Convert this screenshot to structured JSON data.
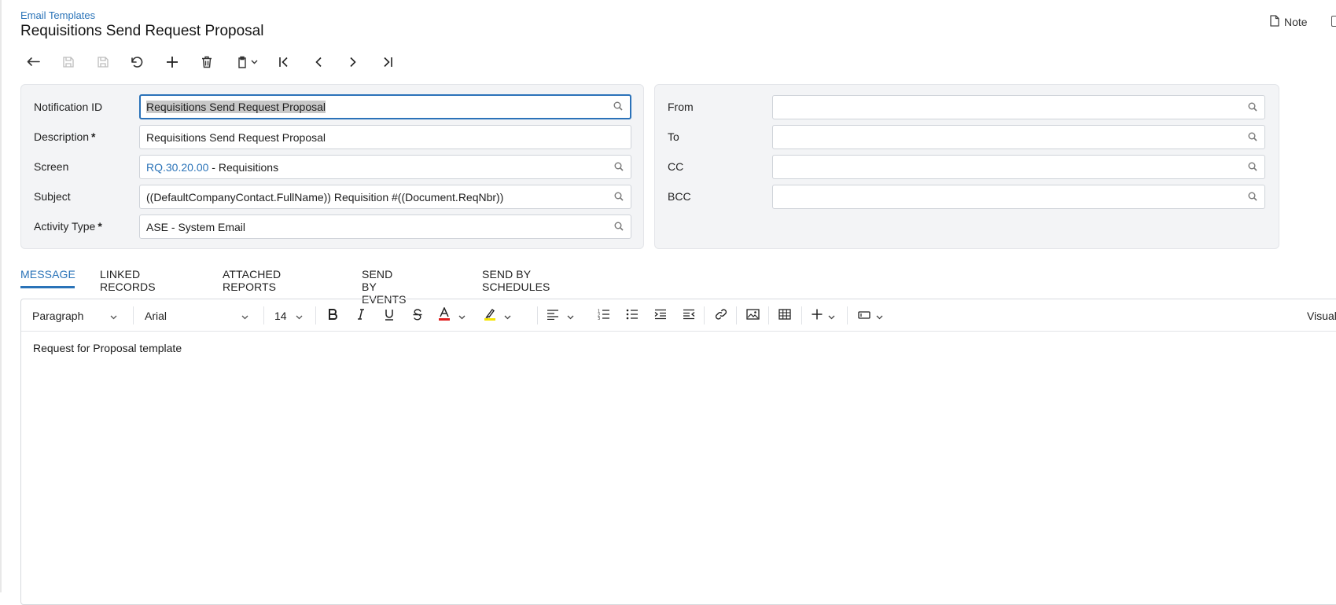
{
  "header": {
    "breadcrumb": "Email Templates",
    "title": "Requisitions Send Request Proposal",
    "note_label": "Note"
  },
  "form": {
    "notification_id": {
      "label": "Notification ID",
      "value": "Requisitions Send Request Proposal"
    },
    "description": {
      "label": "Description",
      "required": "*",
      "value": "Requisitions Send Request Proposal"
    },
    "screen": {
      "label": "Screen",
      "code": "RQ.30.20.00",
      "name": " - Requisitions"
    },
    "subject": {
      "label": "Subject",
      "value": "((DefaultCompanyContact.FullName)) Requisition #((Document.ReqNbr))"
    },
    "activity_type": {
      "label": "Activity Type",
      "required": "*",
      "value": "ASE - System Email"
    },
    "from": {
      "label": "From",
      "value": ""
    },
    "to": {
      "label": "To",
      "value": ""
    },
    "cc": {
      "label": "CC",
      "value": ""
    },
    "bcc": {
      "label": "BCC",
      "value": ""
    }
  },
  "tabs": [
    {
      "label": "MESSAGE",
      "active": true
    },
    {
      "label": "LINKED RECORDS"
    },
    {
      "label": "ATTACHED REPORTS"
    },
    {
      "label": "SEND BY EVENTS"
    },
    {
      "label": "SEND BY SCHEDULES"
    }
  ],
  "editor": {
    "paragraph": "Paragraph",
    "font": "Arial",
    "size": "14",
    "mode": "Visual",
    "body": "Request for Proposal template"
  },
  "colors": {
    "accent": "#2a73b8",
    "panel_bg": "#f3f4f6",
    "text_color_bar": "#e02020",
    "highlight_bar": "#f5e400"
  }
}
